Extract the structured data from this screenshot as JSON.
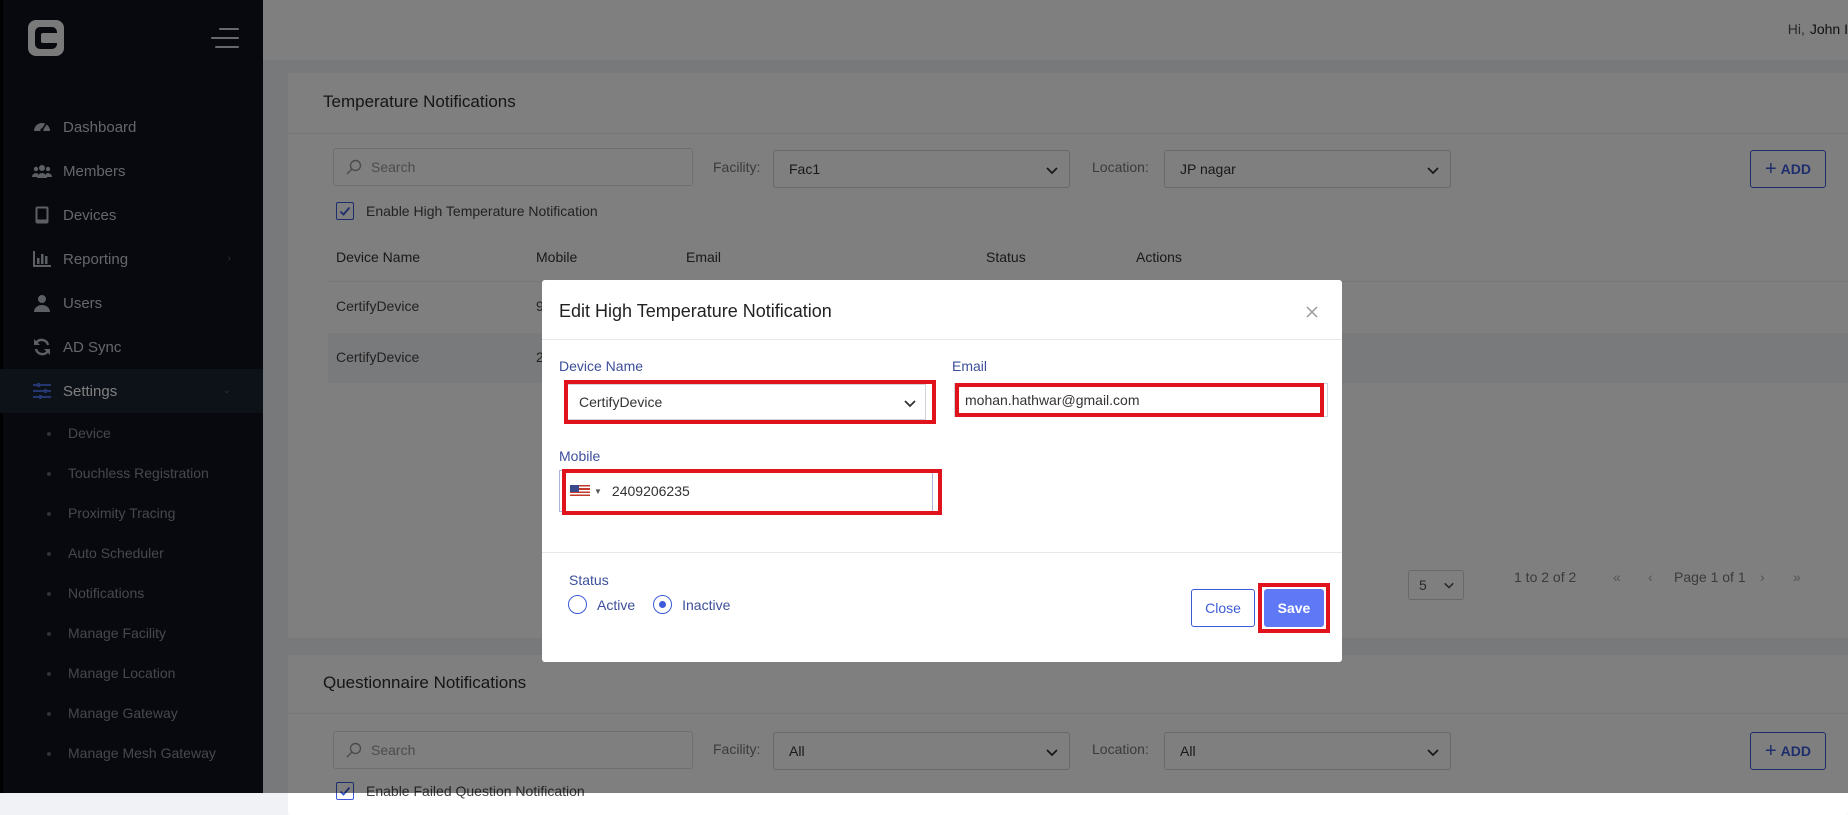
{
  "sidebar": {
    "items": [
      {
        "label": "Dashboard",
        "icon": "dashboard-gauge-icon"
      },
      {
        "label": "Members",
        "icon": "users-group-icon"
      },
      {
        "label": "Devices",
        "icon": "tablet-icon"
      },
      {
        "label": "Reporting",
        "icon": "bar-chart-icon",
        "has_children": true
      },
      {
        "label": "Users",
        "icon": "user-icon"
      },
      {
        "label": "AD Sync",
        "icon": "sync-icon"
      },
      {
        "label": "Settings",
        "icon": "sliders-icon",
        "expanded": true
      }
    ],
    "settings_children": [
      "Device",
      "Touchless Registration",
      "Proximity Tracing",
      "Auto Scheduler",
      "Notifications",
      "Manage Facility",
      "Manage Location",
      "Manage Gateway",
      "Manage Mesh Gateway"
    ]
  },
  "topbar": {
    "greeting": "Hi,",
    "user": "John I"
  },
  "temperature_card": {
    "title": "Temperature Notifications",
    "search_placeholder": "Search",
    "facility_label": "Facility:",
    "facility_value": "Fac1",
    "location_label": "Location:",
    "location_value": "JP nagar",
    "add_label": "ADD",
    "checkbox_label": "Enable High Temperature Notification",
    "columns": [
      "Device Name",
      "Mobile",
      "Email",
      "Status",
      "Actions"
    ],
    "rows": [
      {
        "device": "CertifyDevice",
        "mobile": "9"
      },
      {
        "device": "CertifyDevice",
        "mobile": "2"
      }
    ],
    "page_size": "5",
    "range_text": "1 to 2 of 2",
    "page_text": "Page 1 of 1"
  },
  "questionnaire_card": {
    "title": "Questionnaire Notifications",
    "search_placeholder": "Search",
    "facility_label": "Facility:",
    "facility_value": "All",
    "location_label": "Location:",
    "location_value": "All",
    "add_label": "ADD",
    "checkbox_label": "Enable Failed Question Notification"
  },
  "modal": {
    "title": "Edit High Temperature Notification",
    "device_label": "Device Name",
    "device_value": "CertifyDevice",
    "email_label": "Email",
    "email_value": "mohan.hathwar@gmail.com",
    "mobile_label": "Mobile",
    "mobile_value": "2409206235",
    "status_label": "Status",
    "status_options": [
      "Active",
      "Inactive"
    ],
    "status_selected": "Inactive",
    "close_label": "Close",
    "save_label": "Save"
  },
  "colors": {
    "accent": "#3d5bd8",
    "save_button": "#5f78f5",
    "highlight": "#e0131c",
    "sidebar": "#0e131d"
  }
}
